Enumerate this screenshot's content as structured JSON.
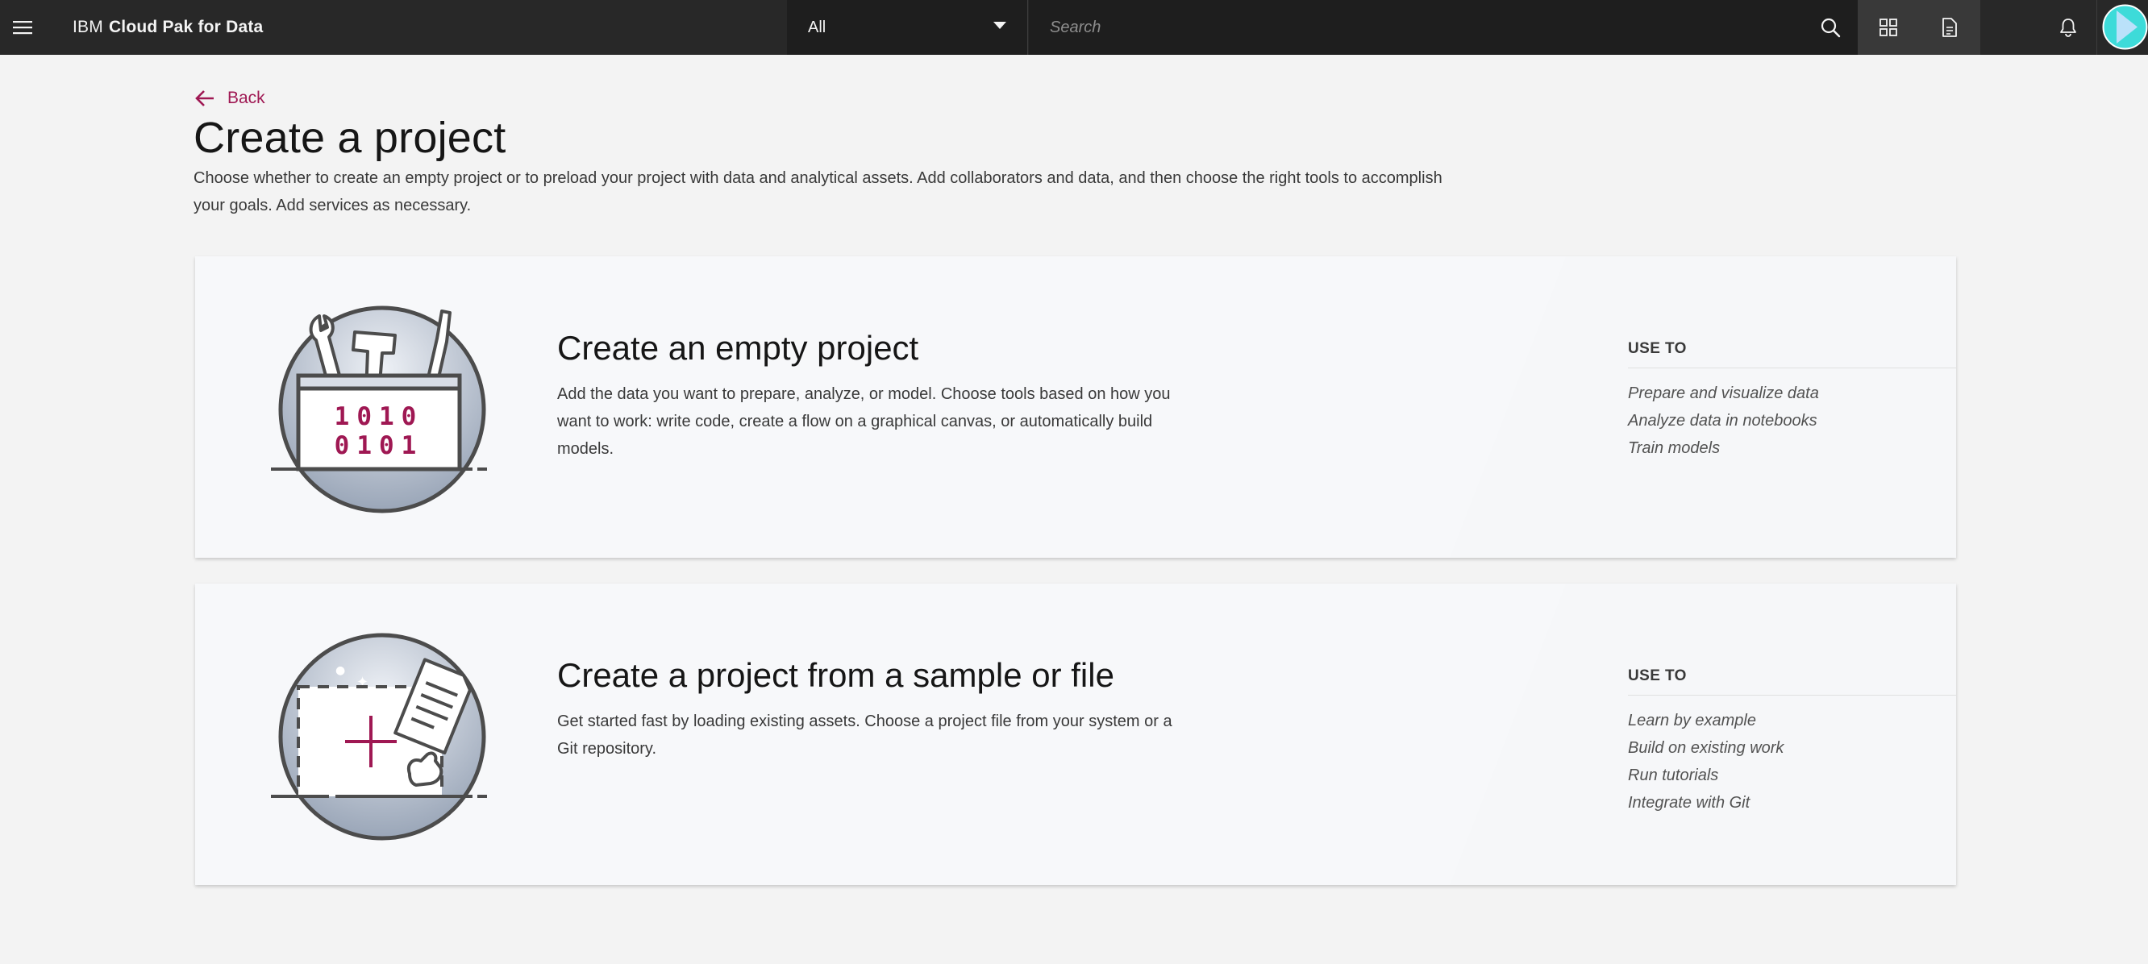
{
  "header": {
    "brand_prefix": "IBM",
    "brand_name": "Cloud Pak for Data",
    "scope_selected": "All",
    "search_placeholder": "Search",
    "icons": [
      "menu-icon",
      "search-icon",
      "grid-icon",
      "document-icon",
      "notification-icon",
      "avatar"
    ]
  },
  "page": {
    "back_label": "Back",
    "title": "Create a project",
    "description": "Choose whether to create an empty project or to preload your project with data and analytical assets. Add collaborators and data, and then choose the right tools to accomplish your goals. Add services as necessary."
  },
  "cards": [
    {
      "title": "Create an empty project",
      "description": "Add the data you want to prepare, analyze, or model. Choose tools based on how you want to work: write code, create a flow on a graphical canvas, or automatically build models.",
      "illustration_text": [
        "1010",
        "0101"
      ],
      "use_to_label": "USE TO",
      "use_to": [
        "Prepare and visualize data",
        "Analyze data in notebooks",
        "Train models"
      ]
    },
    {
      "title": "Create a project from a sample or file",
      "description": "Get started fast by loading existing assets. Choose a project file from your system or a Git repository.",
      "use_to_label": "USE TO",
      "use_to": [
        "Learn by example",
        "Build on existing work",
        "Run tutorials",
        "Integrate with Git"
      ]
    }
  ],
  "colors": {
    "accent": "#9f1853",
    "header_bg": "#282828",
    "page_bg": "#f3f3f3"
  }
}
